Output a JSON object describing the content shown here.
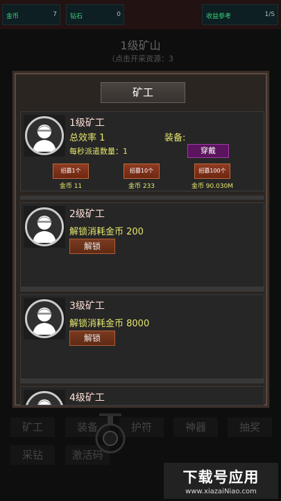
{
  "stats": [
    {
      "label": "金币",
      "value": "7"
    },
    {
      "label": "钻石",
      "value": "0"
    },
    {
      "label": "收益参考",
      "value": "1/S"
    }
  ],
  "mine": {
    "title": "1级矿山",
    "subtitle": "（点击开采资源：3"
  },
  "panel": {
    "title": "矿工"
  },
  "workers": [
    {
      "name": "1级矿工",
      "efficiency": "总效率 1",
      "dispatch": "每秒派遣数量：1",
      "equip_label": "装备:",
      "equip_button": "穿戴",
      "hire": [
        {
          "label": "招募1个",
          "price": "金币 11"
        },
        {
          "label": "招募10个",
          "price": "金币 233"
        },
        {
          "label": "招募100个",
          "price": "金币 90.030M"
        }
      ]
    },
    {
      "name": "2级矿工",
      "unlock_text": "解锁消耗金币 200",
      "unlock_button": "解锁"
    },
    {
      "name": "3级矿工",
      "unlock_text": "解锁消耗金币 8000",
      "unlock_button": "解锁"
    },
    {
      "name": "4级矿工"
    }
  ],
  "nav": [
    "矿工",
    "装备",
    "护符",
    "神器",
    "抽奖",
    "采钻",
    "激活码"
  ],
  "watermark": {
    "line1": "下载号应用",
    "line2": "www.xiazaiNiao.com"
  }
}
